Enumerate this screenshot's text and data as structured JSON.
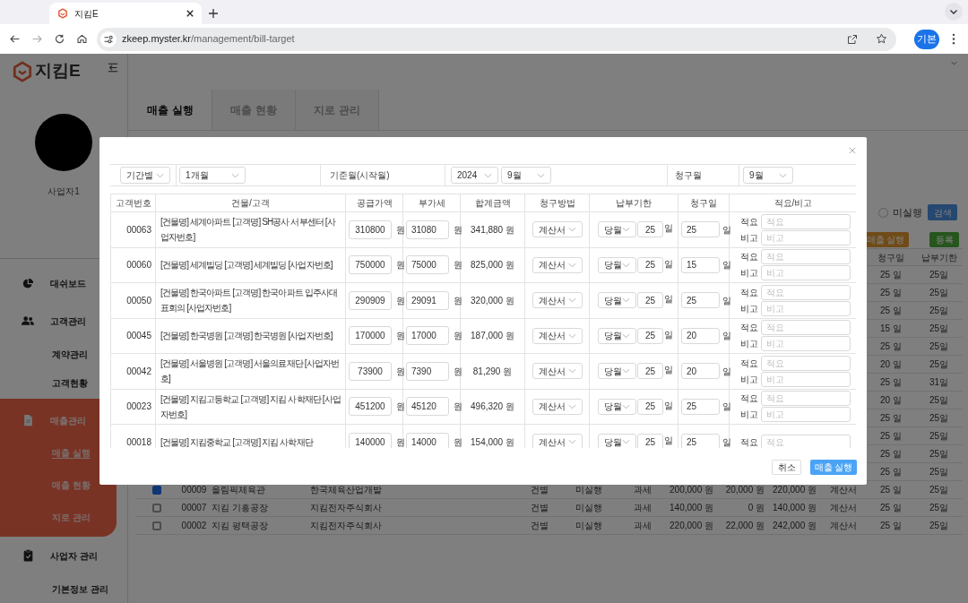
{
  "browser": {
    "tab_title": "지킴E",
    "url_domain": "zkeep.myster.kr",
    "url_path": "/management/bill-target",
    "profile": "기본"
  },
  "sidebar": {
    "logo": "지킴E",
    "user": "사업자1",
    "menu": [
      {
        "label": "대쉬보드",
        "kind": "pie",
        "selected": false
      },
      {
        "label": "고객관리",
        "kind": "people",
        "selected": false,
        "children": [
          {
            "label": "계약관리",
            "selected": false
          },
          {
            "label": "고객현황",
            "selected": false
          }
        ]
      },
      {
        "label": "매출관리",
        "kind": "document",
        "selected": true,
        "children": [
          {
            "label": "매출 실행",
            "selected": true
          },
          {
            "label": "매출 현황",
            "selected": false
          },
          {
            "label": "지로 관리",
            "selected": false
          }
        ]
      },
      {
        "label": "사업자 관리",
        "kind": "clipboard",
        "selected": false,
        "children": [
          {
            "label": "기본정보 관리",
            "selected": false
          }
        ]
      }
    ]
  },
  "page_tabs": [
    {
      "label": "매출 실행",
      "selected": true
    },
    {
      "label": "매출 현황",
      "selected": false
    },
    {
      "label": "지로 관리",
      "selected": false
    }
  ],
  "filter": {
    "status_radio": {
      "label": "미실행",
      "checked": false
    },
    "search_button": "검색"
  },
  "action_buttons": [
    {
      "label": "매출 실행",
      "kind": "execute"
    },
    {
      "label": "등록",
      "kind": "register"
    }
  ],
  "bg_table": {
    "columns": [
      {
        "label": "청구일"
      },
      {
        "label": "납부기한"
      }
    ],
    "rows": [
      {
        "billing_day": "25 일",
        "due_day": "25일"
      },
      {
        "billing_day": "25 일",
        "due_day": "25일"
      },
      {
        "billing_day": "25 일",
        "due_day": "25일"
      },
      {
        "billing_day": "15 일",
        "due_day": "25일"
      },
      {
        "billing_day": "25 일",
        "due_day": "25일"
      },
      {
        "billing_day": "20 일",
        "due_day": "25일"
      },
      {
        "billing_day": "25 일",
        "due_day": "31일"
      },
      {
        "billing_day": "20 일",
        "due_day": "25일"
      },
      {
        "billing_day": "25 일",
        "due_day": "25일"
      },
      {
        "billing_day": "25 일",
        "due_day": "25일"
      },
      {
        "billing_day": "25 일",
        "due_day": "25일"
      },
      {
        "billing_day": "25 일",
        "due_day": "25일"
      },
      {
        "checked": true,
        "customer_no": "00009",
        "building": "올림픽체육관",
        "customer": "한국체육산업개발",
        "type": "건별",
        "status": "미실행",
        "tax": "과세",
        "supply": "200,000 원",
        "vat": "20,000 원",
        "total": "220,000 원",
        "method": "계산서",
        "billing_day": "25 일",
        "due_day": "25일"
      },
      {
        "checked": false,
        "customer_no": "00007",
        "building": "지킴 기흥공장",
        "customer": "지킴전자주식회사",
        "type": "건별",
        "status": "미실행",
        "tax": "과세",
        "supply": "140,000 원",
        "vat": "0 원",
        "total": "140,000 원",
        "method": "계산서",
        "billing_day": "25 일",
        "due_day": "25일"
      },
      {
        "checked": false,
        "customer_no": "00002",
        "building": "지킴 평택공장",
        "customer": "지킴전자주식회사",
        "type": "건별",
        "status": "미실행",
        "tax": "과세",
        "supply": "220,000 원",
        "vat": "22,000 원",
        "total": "242,000 원",
        "method": "계산서",
        "billing_day": "25 일",
        "due_day": "25일"
      }
    ]
  },
  "modal": {
    "filters": {
      "period_type": "기간별",
      "period": "1개월",
      "base_month_label": "기준월(시작월)",
      "year": "2024",
      "month": "9월",
      "billing_month_label": "청구월",
      "billing_month": "9월"
    },
    "columns": [
      "고객번호",
      "건물/고객",
      "공급가액",
      "부가세",
      "합계금액",
      "청구방법",
      "납부기한",
      "청구일",
      "적요/비고"
    ],
    "rows": [
      {
        "customer_no": "00063",
        "description": "[건물명] 세계아파트 [고객명] SH공사 서부센터 [사업자번호]",
        "supply": "310800",
        "supply_unit": "원",
        "vat": "31080",
        "vat_unit": "원",
        "total": "341,880 원",
        "method": "계산서",
        "due_type": "당월",
        "due_day": "25",
        "due_unit": "일",
        "billing_day": "25",
        "billing_unit": "일",
        "memo_label": "적요",
        "memo_placeholder": "적요",
        "note_label": "비고",
        "note_placeholder": "비고"
      },
      {
        "customer_no": "00060",
        "description": "[건물명] 세계빌딩 [고객명] 세계빌딩 [사업자번호]",
        "supply": "750000",
        "supply_unit": "원",
        "vat": "75000",
        "vat_unit": "원",
        "total": "825,000 원",
        "method": "계산서",
        "due_type": "당월",
        "due_day": "25",
        "due_unit": "일",
        "billing_day": "15",
        "billing_unit": "일",
        "memo_label": "적요",
        "memo_placeholder": "적요",
        "note_label": "비고",
        "note_placeholder": "비고"
      },
      {
        "customer_no": "00050",
        "description": "[건물명] 한국아파트 [고객명] 한국아파트 입주사대표회의 [사업자번호]",
        "supply": "290909",
        "supply_unit": "원",
        "vat": "29091",
        "vat_unit": "원",
        "total": "320,000 원",
        "method": "계산서",
        "due_type": "당월",
        "due_day": "25",
        "due_unit": "일",
        "billing_day": "25",
        "billing_unit": "일",
        "memo_label": "적요",
        "memo_placeholder": "적요",
        "note_label": "비고",
        "note_placeholder": "비고"
      },
      {
        "customer_no": "00045",
        "description": "[건물명] 한국병원 [고객명] 한국병원 [사업자번호]",
        "supply": "170000",
        "supply_unit": "원",
        "vat": "17000",
        "vat_unit": "원",
        "total": "187,000 원",
        "method": "계산서",
        "due_type": "당월",
        "due_day": "25",
        "due_unit": "일",
        "billing_day": "20",
        "billing_unit": "일",
        "memo_label": "적요",
        "memo_placeholder": "적요",
        "note_label": "비고",
        "note_placeholder": "비고"
      },
      {
        "customer_no": "00042",
        "description": "[건물명] 서울병원 [고객명] 서울의료재단 [사업자번호]",
        "supply": "73900",
        "supply_unit": "원",
        "vat": "7390",
        "vat_unit": "원",
        "total": "81,290 원",
        "method": "계산서",
        "due_type": "당월",
        "due_day": "25",
        "due_unit": "일",
        "billing_day": "20",
        "billing_unit": "일",
        "memo_label": "적요",
        "memo_placeholder": "적요",
        "note_label": "비고",
        "note_placeholder": "비고"
      },
      {
        "customer_no": "00023",
        "description": "[건물명] 지킴고등학교 [고객명] 지킴 사학재단 [사업자번호]",
        "supply": "451200",
        "supply_unit": "원",
        "vat": "45120",
        "vat_unit": "원",
        "total": "496,320 원",
        "method": "계산서",
        "due_type": "당월",
        "due_day": "25",
        "due_unit": "일",
        "billing_day": "25",
        "billing_unit": "일",
        "memo_label": "적요",
        "memo_placeholder": "적요",
        "note_label": "비고",
        "note_placeholder": "비고"
      },
      {
        "customer_no": "00018",
        "description": "[건물명] 지킴중학교 [고객명] 지킴 사학재단",
        "supply": "140000",
        "supply_unit": "원",
        "vat": "14000",
        "vat_unit": "원",
        "total": "154,000 원",
        "method": "계산서",
        "due_type": "당월",
        "due_day": "25",
        "due_unit": "일",
        "billing_day": "25",
        "billing_unit": "일",
        "memo_label": "적요",
        "memo_placeholder": "적요"
      }
    ]
  },
  "buttons": [
    "취소",
    "매출 실행"
  ]
}
